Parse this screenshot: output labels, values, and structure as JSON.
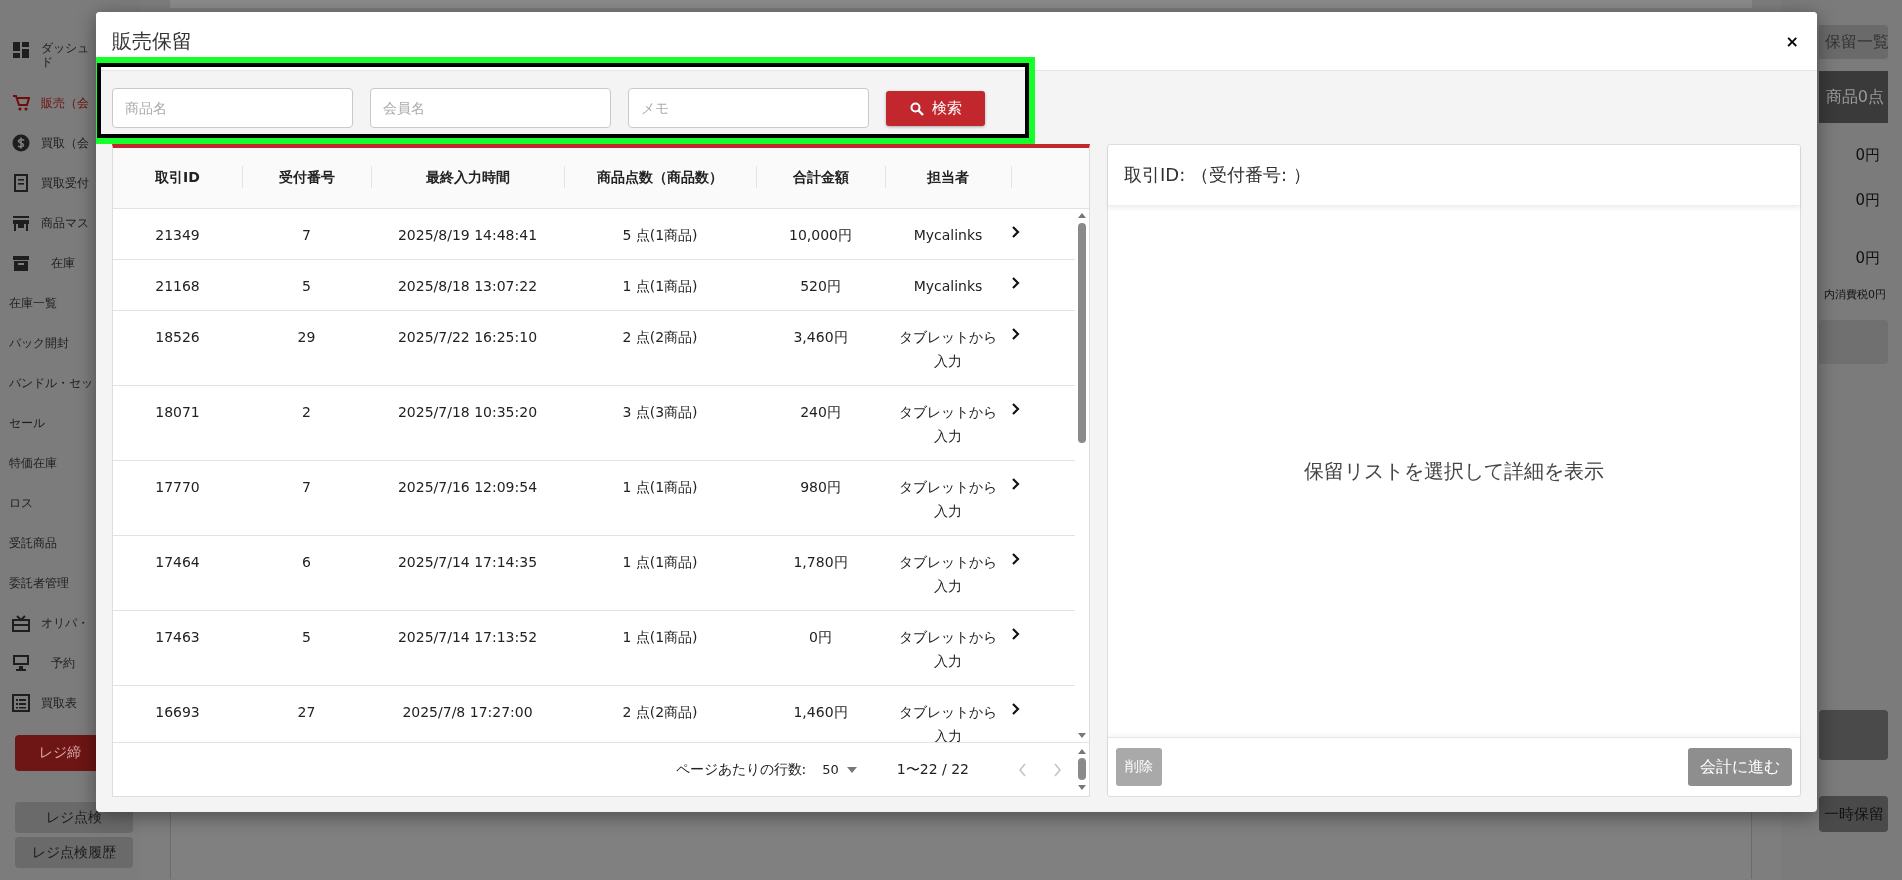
{
  "sidebar": {
    "items": [
      {
        "kind": "main",
        "lines": [
          "ダッシュ",
          "ド"
        ],
        "selected": false
      },
      {
        "kind": "main",
        "lines": [
          "販売（会"
        ],
        "selected": true
      },
      {
        "kind": "main",
        "lines": [
          "買取（会"
        ],
        "selected": false
      },
      {
        "kind": "main",
        "lines": [
          "買取受付"
        ],
        "selected": false
      },
      {
        "kind": "main",
        "lines": [
          "商品マス"
        ],
        "selected": false
      },
      {
        "kind": "main",
        "lines": [
          "在庫"
        ],
        "selected": false
      },
      {
        "kind": "sub",
        "lines": [
          "在庫一覧"
        ],
        "selected": false
      },
      {
        "kind": "sub",
        "lines": [
          "パック開封"
        ],
        "selected": false
      },
      {
        "kind": "sub",
        "lines": [
          "バンドル・セッ"
        ],
        "selected": false
      },
      {
        "kind": "sub",
        "lines": [
          "セール"
        ],
        "selected": false
      },
      {
        "kind": "sub",
        "lines": [
          "特価在庫"
        ],
        "selected": false
      },
      {
        "kind": "sub",
        "lines": [
          "ロス"
        ],
        "selected": false
      },
      {
        "kind": "sub",
        "lines": [
          "受託商品"
        ],
        "selected": false
      },
      {
        "kind": "sub",
        "lines": [
          "委託者管理"
        ],
        "selected": false
      },
      {
        "kind": "main",
        "lines": [
          "オリパ・"
        ],
        "selected": false
      },
      {
        "kind": "main",
        "lines": [
          "予約"
        ],
        "selected": false
      },
      {
        "kind": "main",
        "lines": [
          "買取表"
        ],
        "selected": false
      }
    ],
    "buttons": [
      {
        "kind": "primary",
        "label": "レジ締"
      },
      {
        "kind": "secondary",
        "label": "レジ点検"
      },
      {
        "kind": "secondary",
        "label": "レジ点検履歴"
      }
    ]
  },
  "summary": {
    "hold_list_button": "保留一覧",
    "items_bar": "商品0点",
    "amounts": [
      "0円",
      "0円",
      "0円"
    ],
    "tax_note": "内消費税0円",
    "hold_button": "一時保留"
  },
  "modal": {
    "title": "販売保留",
    "close": "×",
    "search": {
      "highlighted": true,
      "fields": [
        {
          "placeholder": "商品名"
        },
        {
          "placeholder": "会員名"
        },
        {
          "placeholder": "メモ"
        }
      ],
      "button": "検索"
    },
    "table": {
      "columns": [
        "取引ID",
        "受付番号",
        "最終入力時間",
        "商品点数（商品数）",
        "合計金額",
        "担当者"
      ],
      "rows": [
        [
          "21349",
          "7",
          "2025/8/19 14:48:41",
          "5 点(1商品)",
          "10,000円",
          "Mycalinks"
        ],
        [
          "21168",
          "5",
          "2025/8/18 13:07:22",
          "1 点(1商品)",
          "520円",
          "Mycalinks"
        ],
        [
          "18526",
          "29",
          "2025/7/22 16:25:10",
          "2 点(2商品)",
          "3,460円",
          "タブレットから入力"
        ],
        [
          "18071",
          "2",
          "2025/7/18 10:35:20",
          "3 点(3商品)",
          "240円",
          "タブレットから入力"
        ],
        [
          "17770",
          "7",
          "2025/7/16 12:09:54",
          "1 点(1商品)",
          "980円",
          "タブレットから入力"
        ],
        [
          "17464",
          "6",
          "2025/7/14 17:14:35",
          "1 点(1商品)",
          "1,780円",
          "タブレットから入力"
        ],
        [
          "17463",
          "5",
          "2025/7/14 17:13:52",
          "1 点(1商品)",
          "0円",
          "タブレットから入力"
        ],
        [
          "16693",
          "27",
          "2025/7/8 17:27:00",
          "2 点(2商品)",
          "1,460円",
          "タブレットから入力"
        ]
      ]
    },
    "pagination": {
      "rows_per_page_label": "ページあたりの行数:",
      "rows_per_page": "50",
      "range": "1〜22 / 22",
      "prev_disabled": true,
      "next_disabled": true
    },
    "detail": {
      "header": "取引ID: （受付番号: ）",
      "empty_message": "保留リストを選択して詳細を表示",
      "buttons": [
        {
          "kind": "danger",
          "label": "削除",
          "disabled": true
        },
        {
          "kind": "primary",
          "label": "会計に進む",
          "disabled": true
        }
      ]
    }
  }
}
